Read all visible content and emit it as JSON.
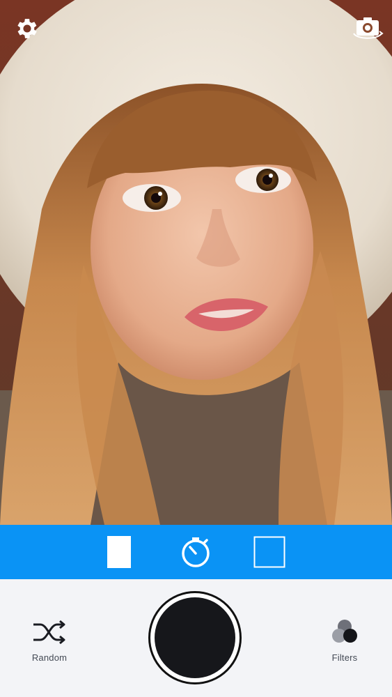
{
  "preview": {
    "subject": "portrait-photo"
  },
  "top_bar": {
    "settings_icon": "gear-icon",
    "switch_camera_icon": "camera-switch-icon"
  },
  "toolbar": {
    "background_color": "#0a93f5",
    "tools": [
      {
        "icon": "portrait-frame-icon",
        "state": "selected"
      },
      {
        "icon": "timer-icon",
        "state": "default"
      },
      {
        "icon": "square-frame-icon",
        "state": "default"
      }
    ]
  },
  "controls": {
    "random": {
      "label": "Random",
      "icon": "shuffle-icon"
    },
    "shutter": {
      "icon": "shutter-button"
    },
    "filters": {
      "label": "Filters",
      "icon": "filters-icon"
    }
  }
}
